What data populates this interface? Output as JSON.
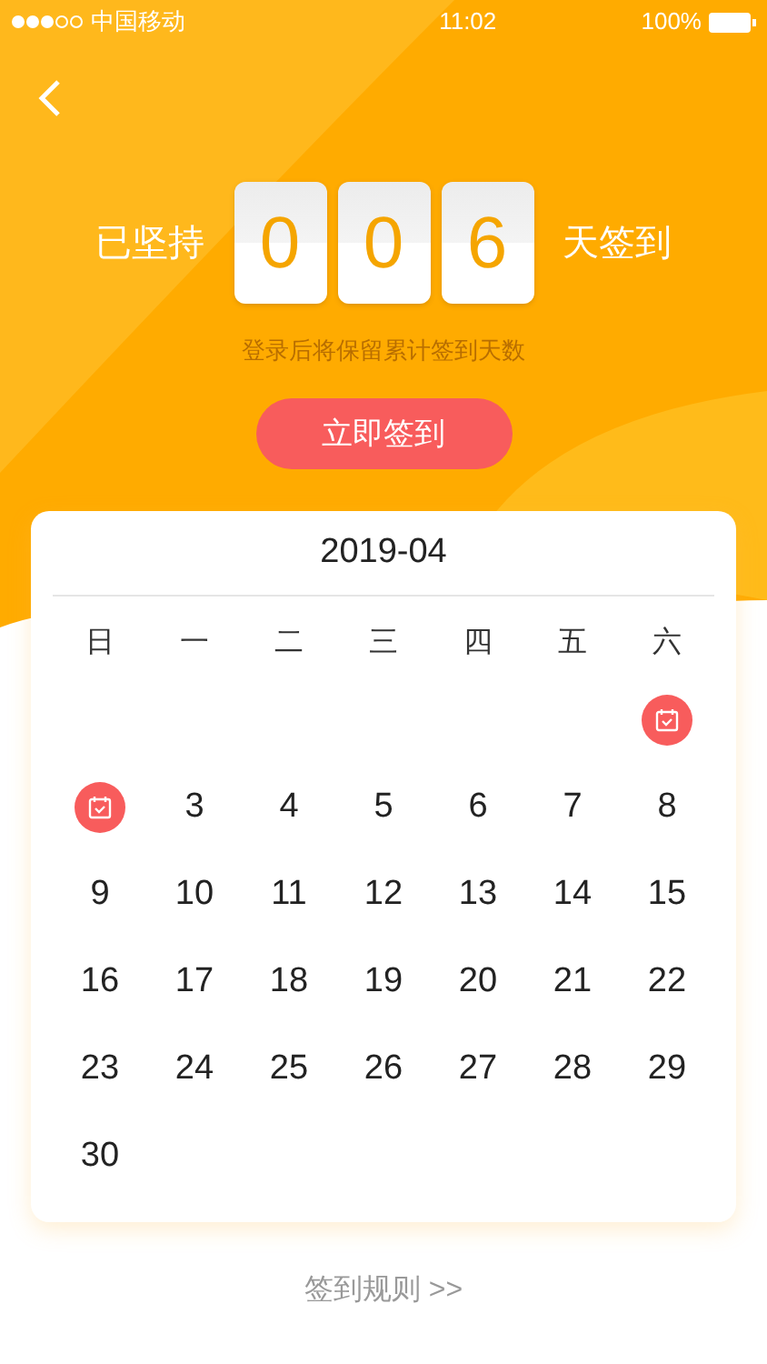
{
  "status_bar": {
    "carrier": "中国移动",
    "time": "11:02",
    "battery": "100%"
  },
  "streak": {
    "prefix": "已坚持",
    "digits": [
      "0",
      "0",
      "6"
    ],
    "suffix": "天签到",
    "hint": "登录后将保留累计签到天数"
  },
  "sign_button": "立即签到",
  "calendar": {
    "month": "2019-04",
    "weekdays": [
      "日",
      "一",
      "二",
      "三",
      "四",
      "五",
      "六"
    ],
    "weeks": [
      [
        {
          "kind": "empty"
        },
        {
          "kind": "empty"
        },
        {
          "kind": "empty"
        },
        {
          "kind": "empty"
        },
        {
          "kind": "empty"
        },
        {
          "kind": "empty"
        },
        {
          "kind": "signed"
        }
      ],
      [
        {
          "kind": "signed"
        },
        {
          "kind": "day",
          "day": "3"
        },
        {
          "kind": "day",
          "day": "4"
        },
        {
          "kind": "day",
          "day": "5"
        },
        {
          "kind": "day",
          "day": "6"
        },
        {
          "kind": "day",
          "day": "7"
        },
        {
          "kind": "day",
          "day": "8"
        }
      ],
      [
        {
          "kind": "day",
          "day": "9"
        },
        {
          "kind": "day",
          "day": "10"
        },
        {
          "kind": "day",
          "day": "11"
        },
        {
          "kind": "day",
          "day": "12"
        },
        {
          "kind": "day",
          "day": "13"
        },
        {
          "kind": "day",
          "day": "14"
        },
        {
          "kind": "day",
          "day": "15"
        }
      ],
      [
        {
          "kind": "day",
          "day": "16"
        },
        {
          "kind": "day",
          "day": "17"
        },
        {
          "kind": "day",
          "day": "18"
        },
        {
          "kind": "day",
          "day": "19"
        },
        {
          "kind": "day",
          "day": "20"
        },
        {
          "kind": "day",
          "day": "21"
        },
        {
          "kind": "day",
          "day": "22"
        }
      ],
      [
        {
          "kind": "day",
          "day": "23"
        },
        {
          "kind": "day",
          "day": "24"
        },
        {
          "kind": "day",
          "day": "25"
        },
        {
          "kind": "day",
          "day": "26"
        },
        {
          "kind": "day",
          "day": "27"
        },
        {
          "kind": "day",
          "day": "28"
        },
        {
          "kind": "day",
          "day": "29"
        }
      ],
      [
        {
          "kind": "day",
          "day": "30"
        }
      ]
    ]
  },
  "rules_link": "签到规则 >>"
}
